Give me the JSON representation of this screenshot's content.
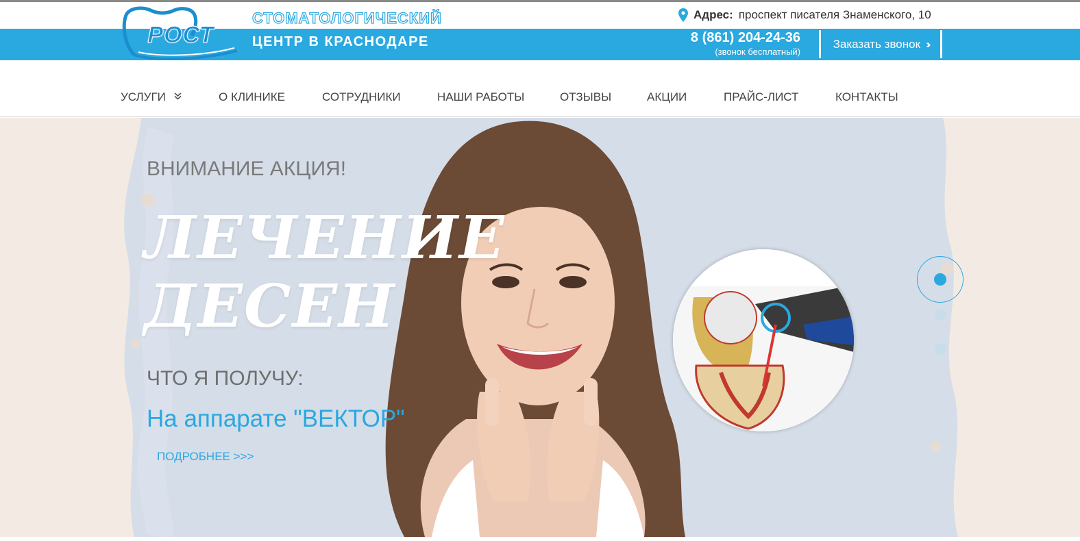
{
  "header": {
    "logo_text": "РОСТ",
    "tagline_line1": "СТОМАТОЛОГИЧЕСКИЙ",
    "tagline_line2": "ЦЕНТР В КРАСНОДАРЕ",
    "address_label": "Адрес:",
    "address_value": "проспект писателя Знаменского, 10",
    "phone": "8 (861) 204-24-36",
    "phone_note": "(звонок бесплатный)",
    "callback_label": "Заказать звонок",
    "callback_icon": "double-chevron-right"
  },
  "nav": {
    "items": [
      {
        "label": "Услуги",
        "has_dropdown": true
      },
      {
        "label": "О клинике"
      },
      {
        "label": "Сотрудники"
      },
      {
        "label": "Наши работы"
      },
      {
        "label": "Отзывы"
      },
      {
        "label": "Акции"
      },
      {
        "label": "Прайс-лист"
      },
      {
        "label": "Контакты"
      }
    ]
  },
  "slider": {
    "kicker": "ВНИМАНИЕ АКЦИЯ!",
    "title_line1": "ЛЕЧЕНИЕ",
    "title_line2": "ДЕСЕН",
    "subtitle": "ЧТО Я ПОЛУЧУ:",
    "device": "На аппарате \"ВЕКТОР\"",
    "more_link": "ПОДРОБНЕЕ >>>",
    "active_slide": 1,
    "slide_count": 3
  },
  "colors": {
    "accent": "#2aa8e0",
    "hero_background": "#f3ebe3",
    "splash": "#d6dee9",
    "nav_text": "#444444"
  }
}
